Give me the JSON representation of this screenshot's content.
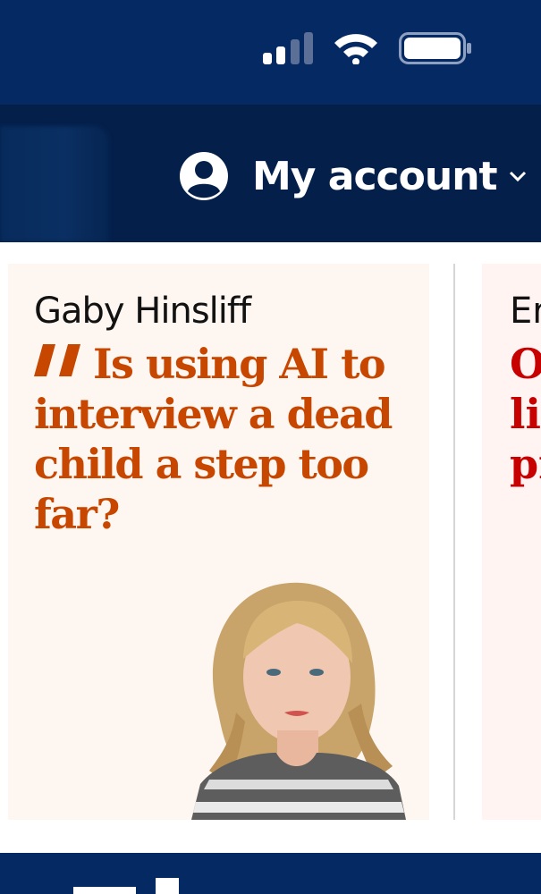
{
  "status_bar": {
    "signal_icon": "cellular-signal-icon",
    "wifi_icon": "wifi-icon",
    "battery_icon": "battery-icon"
  },
  "nav": {
    "account_icon": "user-circle-icon",
    "account_label": "My account",
    "chevron_icon": "chevron-down-icon"
  },
  "cards": [
    {
      "byline": "Gaby Hinsliff",
      "quote_icon": "quote-icon",
      "headline": "Is using AI to interview a dead child a step too far?",
      "image": "author-portrait"
    },
    {
      "byline": "Er",
      "headline": "O\nlif\npr"
    }
  ],
  "colors": {
    "brand_navy": "#052962",
    "opinion_accent": "#c74600",
    "news_accent": "#c70000",
    "card_bg": "#fdf6f1"
  }
}
